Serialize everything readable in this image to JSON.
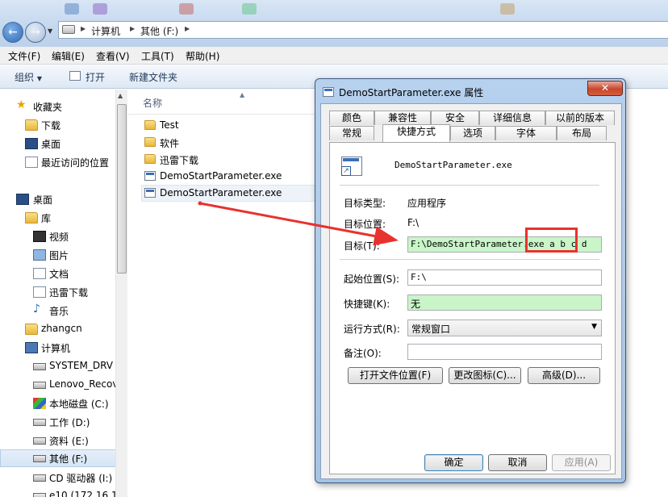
{
  "window": {
    "breadcrumbs": [
      "计算机",
      "其他 (F:)"
    ],
    "menu": [
      "文件(F)",
      "编辑(E)",
      "查看(V)",
      "工具(T)",
      "帮助(H)"
    ],
    "toolbar": {
      "organize": "组织",
      "open": "打开",
      "new_folder": "新建文件夹"
    }
  },
  "nav": {
    "favorites": {
      "label": "收藏夹",
      "items": [
        "下载",
        "桌面",
        "最近访问的位置"
      ]
    },
    "desktop": "桌面",
    "libraries": {
      "label": "库",
      "items": [
        "视频",
        "图片",
        "文档",
        "迅雷下载",
        "音乐"
      ]
    },
    "user": "zhangcn",
    "computer": {
      "label": "计算机",
      "drives": [
        "SYSTEM_DRV",
        "Lenovo_Recov",
        "本地磁盘 (C:)",
        "工作 (D:)",
        "资料 (E:)",
        "其他 (F:)",
        "CD 驱动器 (I:)",
        "e10 (172.16.1"
      ]
    }
  },
  "content": {
    "column_name": "名称",
    "files": [
      {
        "name": "Test",
        "type": "folder"
      },
      {
        "name": "软件",
        "type": "folder"
      },
      {
        "name": "迅雷下载",
        "type": "folder"
      },
      {
        "name": "DemoStartParameter.exe",
        "type": "exe"
      },
      {
        "name": "DemoStartParameter.exe",
        "type": "shortcut"
      }
    ]
  },
  "dialog": {
    "title": "DemoStartParameter.exe 属性",
    "close": "✕",
    "tabs_row1": [
      "颜色",
      "兼容性",
      "安全",
      "详细信息",
      "以前的版本"
    ],
    "tabs_row2": [
      "常规",
      "快捷方式",
      "选项",
      "字体",
      "布局"
    ],
    "file_name": "DemoStartParameter.exe",
    "labels": {
      "target_type": "目标类型:",
      "target_location": "目标位置:",
      "target": "目标(T):",
      "start_in": "起始位置(S):",
      "shortcut_key": "快捷键(K):",
      "run": "运行方式(R):",
      "comment": "备注(O):"
    },
    "values": {
      "target_type": "应用程序",
      "target_location": "F:\\",
      "target": "F:\\DemoStartParameter.exe a b c d",
      "start_in": "F:\\",
      "shortcut_key": "无",
      "run": "常规窗口",
      "comment": ""
    },
    "buttons": {
      "open_location": "打开文件位置(F)",
      "change_icon": "更改图标(C)...",
      "advanced": "高级(D)...",
      "ok": "确定",
      "cancel": "取消",
      "apply": "应用(A)"
    }
  },
  "colors": {
    "annotation": "#e8322e",
    "highlight_field": "#c9f5c9"
  }
}
